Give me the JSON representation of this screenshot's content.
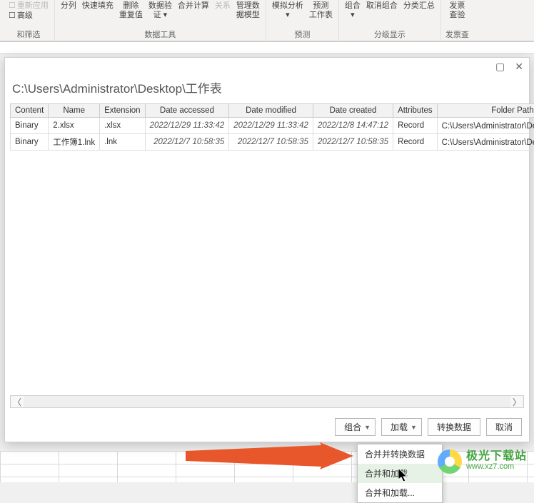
{
  "ribbon": {
    "left": {
      "advanced": "高级",
      "reapp": "重新应用",
      "filter_group_label": "和筛选"
    },
    "columns": "分列",
    "flashfill": "快速填充",
    "removeDup1": "删除",
    "removeDup2": "重复值",
    "dataVal1": "数据验",
    "dataVal2": "证 ▾",
    "consolidate": "合并计算",
    "relations": "关系",
    "manage1": "管理数",
    "manage2": "据模型",
    "datatools_label": "数据工具",
    "whatif1": "模拟分析",
    "whatif2": "▾",
    "forecast1": "预测",
    "forecast2": "工作表",
    "forecast_label": "预测",
    "group1": "组合",
    "group2": "▾",
    "ungroup": "取消组合",
    "subtotal": "分类汇总",
    "outline_label": "分级显示",
    "fapiao1": "发票",
    "fapiao2": "查验",
    "fapiao_label": "发票查"
  },
  "dialog": {
    "path": "C:\\Users\\Administrator\\Desktop\\工作表",
    "headers": [
      "Content",
      "Name",
      "Extension",
      "Date accessed",
      "Date modified",
      "Date created",
      "Attributes",
      "Folder Path"
    ],
    "rows": [
      {
        "content": "Binary",
        "name": "2.xlsx",
        "ext": ".xlsx",
        "da": "2022/12/29 11:33:42",
        "dm": "2022/12/29 11:33:42",
        "dc": "2022/12/8 14:47:12",
        "attr": "Record",
        "fp": "C:\\Users\\Administrator\\Desktop\\工作表"
      },
      {
        "content": "Binary",
        "name": "工作簿1.lnk",
        "ext": ".lnk",
        "da": "2022/12/7 10:58:35",
        "dm": "2022/12/7 10:58:35",
        "dc": "2022/12/7 10:58:35",
        "attr": "Record",
        "fp": "C:\\Users\\Administrator\\Desktop\\工作表"
      }
    ],
    "buttons": {
      "combine": "组合",
      "load": "加载",
      "transform": "转换数据",
      "cancel": "取消"
    },
    "menu": {
      "i1": "合并并转换数据",
      "i2": "合并和加载",
      "i3": "合并和加载..."
    }
  },
  "watermark": {
    "t1": "极光下载站",
    "t2": "www.xz7.com"
  }
}
